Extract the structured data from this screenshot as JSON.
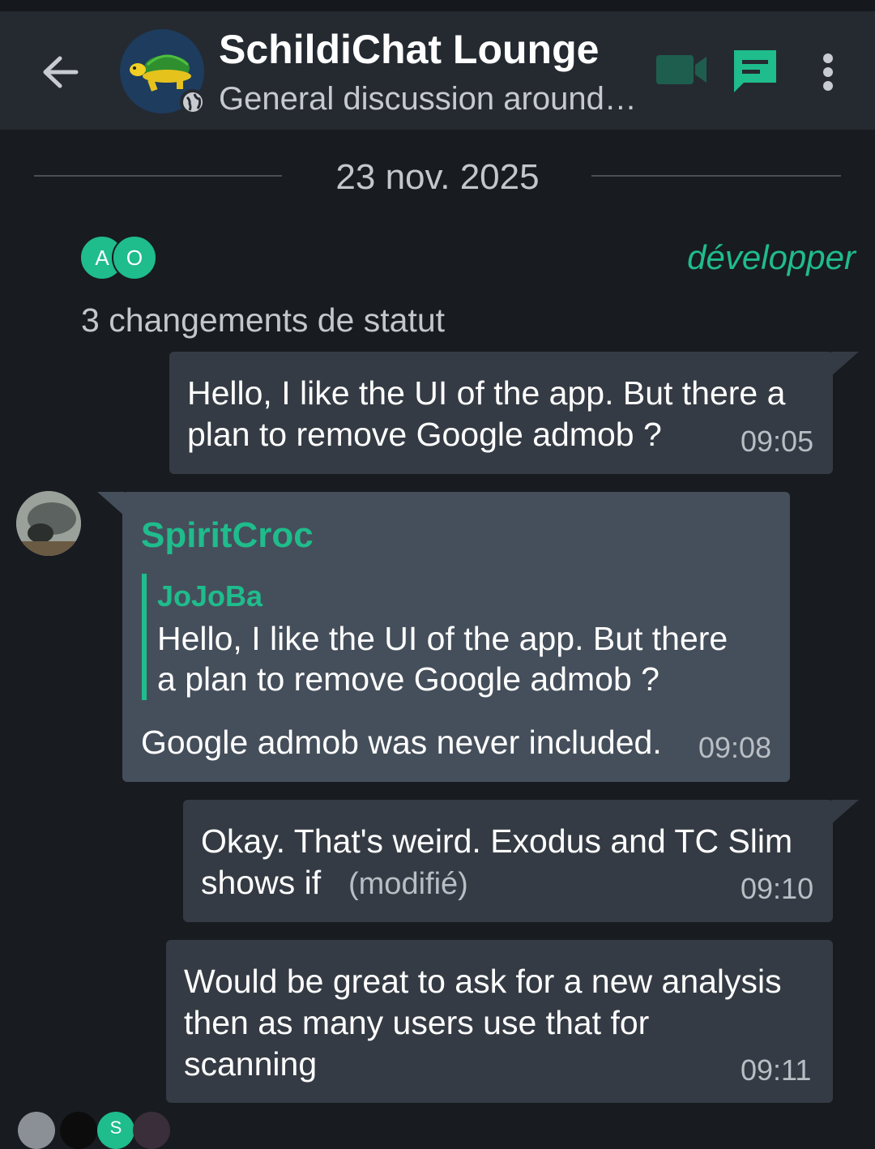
{
  "header": {
    "room_name": "SchildiChat Lounge",
    "topic": "General discussion around…",
    "icons": [
      "back-arrow-icon",
      "room-avatar-turtle",
      "globe-icon",
      "video-call-icon",
      "threads-icon",
      "more-vert-icon"
    ],
    "colors": {
      "accent": "#1fbc8c",
      "appbar": "#252a31",
      "background": "#181b20"
    }
  },
  "timeline": {
    "date_separator": "23 nov. 2025",
    "read_avatars": [
      "A",
      "O"
    ],
    "role_label": "développer",
    "status_changes": "3 changements de statut",
    "messages": [
      {
        "line1": "Hello, I like the UI of the app. But there a",
        "line2": "plan to remove Google admob ?",
        "time": "09:05"
      },
      {
        "sender": "SpiritCroc",
        "quote_author": "JoJoBa",
        "quote_line1": "Hello, I like the UI of the app. But there",
        "quote_line2": "a plan to remove Google admob ?",
        "text": "Google admob was never included.",
        "time": "09:08"
      },
      {
        "line1": "Okay. That's weird. Exodus and TC Slim",
        "line2": "shows if",
        "edited": "(modifié)",
        "time": "09:10"
      },
      {
        "line1": "Would be great to ask for a new analysis",
        "line2": "then as many users use that for",
        "line3": "scanning",
        "time": "09:11"
      }
    ],
    "read_receipt_letter": "S"
  }
}
